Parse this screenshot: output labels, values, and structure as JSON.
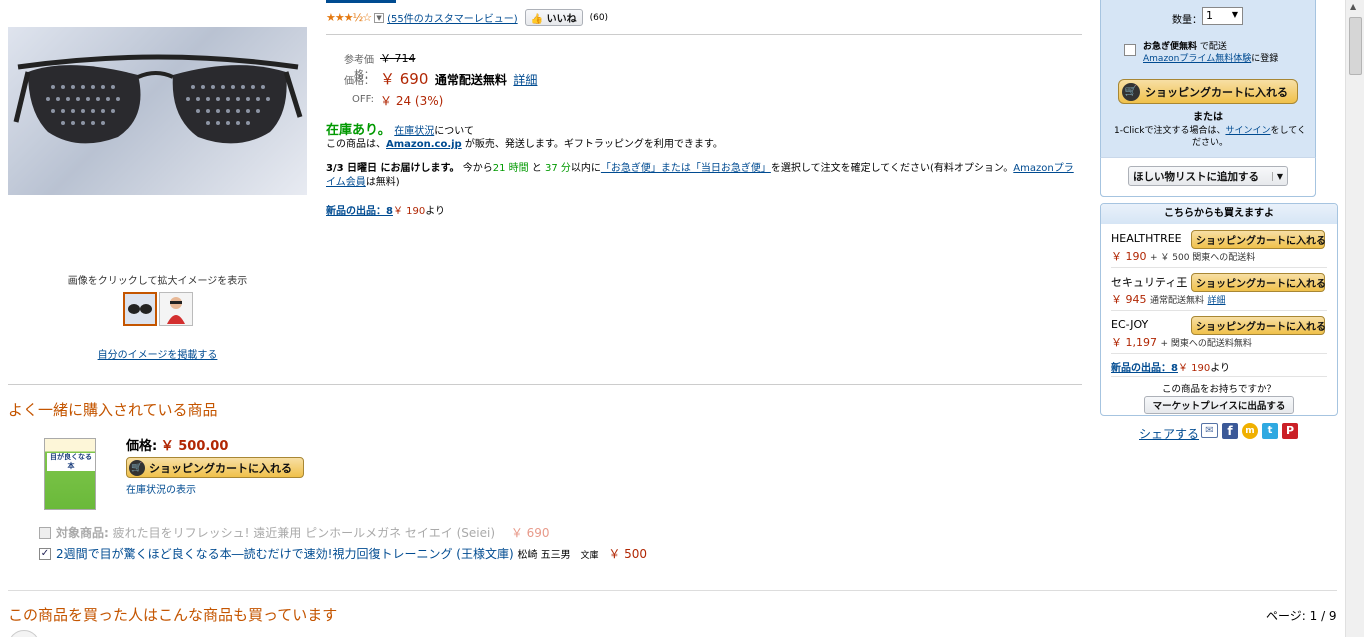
{
  "product": {
    "rating_stars": "★★★½☆",
    "review_link": "(55件のカスタマーレビュー)",
    "like_label": "いいね",
    "like_count": "(60)",
    "list_price_label": "参考価格：",
    "list_price": "￥ 714",
    "price_label": "価格：",
    "price": "￥ 690",
    "shipping": "通常配送無料",
    "shipping_detail": "詳細",
    "off_label": "OFF:",
    "off_value": "￥ 24 (3%)",
    "stock": "在庫あり。",
    "stock_link": "在庫状況",
    "stock_suffix": "について",
    "seller_prefix": "この商品は、",
    "seller": "Amazon.co.jp",
    "seller_suffix": " が販売、発送します。ギフトラッピングを利用できます。",
    "delivery_bold": "3/3 日曜日 にお届けします。",
    "delivery_1": "今から",
    "delivery_hours": "21 時間",
    "delivery_2": " と ",
    "delivery_mins": "37 分",
    "delivery_3": "以内に",
    "delivery_link": "「お急ぎ便」または「当日お急ぎ便」",
    "delivery_4": "を選択して注文を確定してください(有料オプション。",
    "prime_link": "Amazonプライム会員",
    "delivery_5": "は無料)",
    "new_offers_link": "新品の出品：8",
    "new_offers_price": "￥ 190",
    "new_offers_suffix": "より"
  },
  "image_area": {
    "caption": "画像をクリックして拡大イメージを表示",
    "upload_link": "自分のイメージを掲載する"
  },
  "buybox": {
    "qty_label": "数量：",
    "qty_value": "1",
    "express_bold": "お急ぎ便無料",
    "express_text": "で配送",
    "prime_trial_link": "Amazonプライム無料体験",
    "prime_trial_suffix": "に登録",
    "cart_button": "ショッピングカートに入れる",
    "or": "または",
    "oneclick_text": "1-Clickで注文する場合は、",
    "signin_link": "サインイン",
    "oneclick_suffix": "をしてください。",
    "wishlist_button": "ほしい物リストに追加する"
  },
  "other_sellers": {
    "title": "こちらからも買えますよ",
    "cart_button": "ショッピングカートに入れる",
    "sellers": [
      {
        "name": "HEALTHTREE",
        "price": "￥ 190",
        "shipping": "+ ￥ 500 関東への配送料"
      },
      {
        "name": "セキュリティ王",
        "price": "￥ 945",
        "shipping": "通常配送無料",
        "detail": "詳細"
      },
      {
        "name": "EC-JOY",
        "price": "￥ 1,197",
        "shipping": "+ 関東への配送料無料"
      }
    ],
    "new_offers_link": "新品の出品：8",
    "new_offers_price": "￥ 190",
    "new_offers_suffix": "より",
    "have_item": "この商品をお持ちですか？",
    "marketplace_button": "マーケットプレイスに出品する"
  },
  "share": {
    "label": "シェアする"
  },
  "bought_together": {
    "heading": "よく一緒に購入されている商品",
    "price_label": "価格:",
    "price": "￥ 500.00",
    "cart_button": "ショッピングカートに入れる",
    "stock_link": "在庫状況の表示",
    "book_cover_text": "目が良くなる本",
    "items": [
      {
        "label": "対象商品:",
        "title": "疲れた目をリフレッシュ! 遠近兼用 ピンホールメガネ セイエイ (Seiei)",
        "price": "￥ 690"
      },
      {
        "title": "2週間で目が驚くほど良くなる本―読むだけで速効!視力回復トレーニング (王様文庫)",
        "author": "松崎 五三男",
        "format": "文庫",
        "price": "￥ 500"
      }
    ]
  },
  "also_bought": {
    "heading": "この商品を買った人はこんな商品も買っています",
    "page": "ページ: 1 / 9"
  }
}
